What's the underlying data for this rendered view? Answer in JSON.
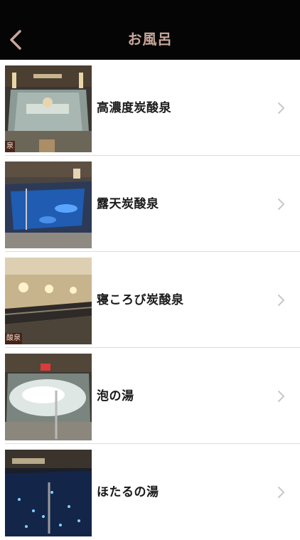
{
  "navbar": {
    "title": "お風呂",
    "back_icon": "chevron-left-icon",
    "title_color": "#c9a79b",
    "background": "#050505"
  },
  "baths": [
    {
      "name": "高濃度炭酸泉",
      "thumb_caption": "泉",
      "icon": "chevron-right-icon"
    },
    {
      "name": "露天炭酸泉",
      "thumb_caption": "",
      "icon": "chevron-right-icon"
    },
    {
      "name": "寝ころび炭酸泉",
      "thumb_caption": "酸泉",
      "icon": "chevron-right-icon"
    },
    {
      "name": "泡の湯",
      "thumb_caption": "",
      "icon": "chevron-right-icon"
    },
    {
      "name": "ほたるの湯",
      "thumb_caption": "",
      "icon": "chevron-right-icon"
    }
  ]
}
